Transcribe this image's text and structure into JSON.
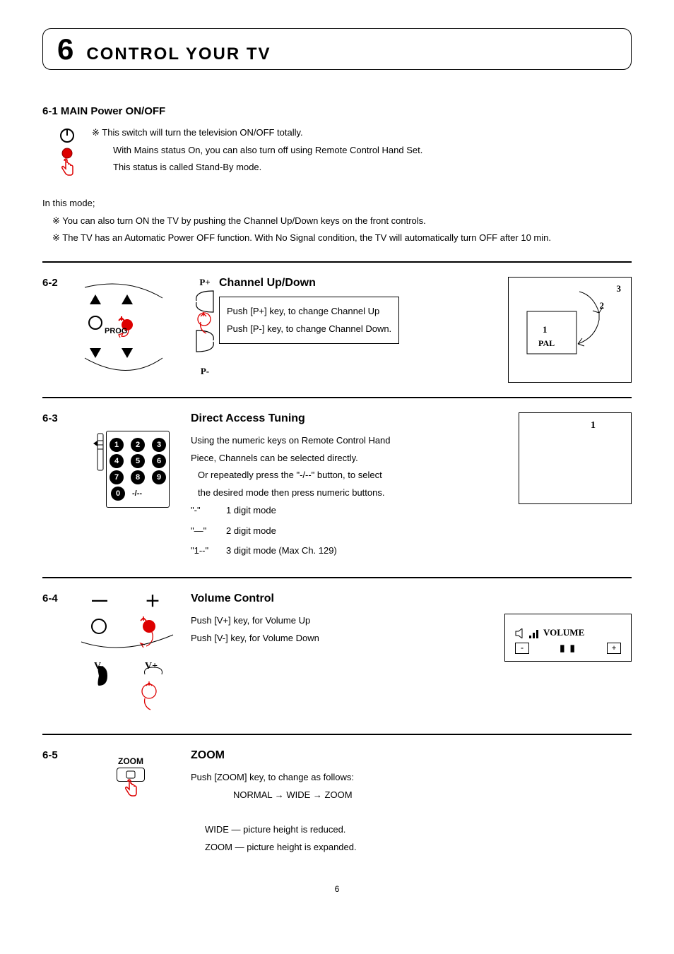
{
  "chapter": {
    "number": "6",
    "title": "CONTROL YOUR TV"
  },
  "s61": {
    "num": "6-1",
    "title": "MAIN Power ON/OFF",
    "line1": "※ This switch will turn the television ON/OFF totally.",
    "line2": "With Mains status On, you can also turn off using Remote Control Hand Set.",
    "line3": "This status is called Stand-By mode.",
    "mode": "In this mode;",
    "note1": "※ You can also turn ON the TV by pushing the Channel Up/Down keys on the front controls.",
    "note2": "※ The TV has an Automatic Power OFF function. With No Signal condition, the TV will automatically turn OFF after 10 min."
  },
  "s62": {
    "num": "6-2",
    "title": "Channel Up/Down",
    "line1": "Push [P+] key, to change Channel Up",
    "line2": "Push [P-] key, to change Channel Down.",
    "diag": {
      "prog": "PROG",
      "pplus": "P+",
      "pminus": "P-",
      "n1": "1",
      "n2": "2",
      "n3": "3",
      "pal": "PAL"
    }
  },
  "s63": {
    "num": "6-3",
    "title": "Direct Access Tuning",
    "line1": "Using the numeric keys on Remote Control Hand",
    "line2": "Piece, Channels can be selected directly.",
    "line3": "Or repeatedly press the \"-/--\" button, to select",
    "line4": "the desired mode then press numeric buttons.",
    "modes": [
      {
        "key": "\"-\"",
        "desc": "1 digit mode"
      },
      {
        "key": "\"—\"",
        "desc": "2 digit mode"
      },
      {
        "key": "\"1--\"",
        "desc": "3 digit mode (Max Ch. 129)"
      }
    ],
    "keypad": {
      "dash": "-/--",
      "keys": [
        "1",
        "2",
        "3",
        "4",
        "5",
        "6",
        "7",
        "8",
        "9",
        "0"
      ]
    },
    "osd_num": "1"
  },
  "s64": {
    "num": "6-4",
    "title": "Volume Control",
    "line1": "Push [V+] key, for Volume Up",
    "line2": "Push [V-] key, for Volume Down",
    "diag": {
      "vminus": "V-",
      "vplus": "V+",
      "minus_sym": "—",
      "plus_sym": "＋"
    },
    "osd": {
      "label": "VOLUME",
      "bar": "▮ ▮",
      "minus": "-",
      "plus": "+"
    }
  },
  "s65": {
    "num": "6-5",
    "title": "ZOOM",
    "btn": "ZOOM",
    "line1": "Push [ZOOM] key, to change as follows:",
    "sequence": "NORMAL → WIDE → ZOOM",
    "wide": "WIDE — picture height is reduced.",
    "zoom": "ZOOM — picture height is expanded."
  },
  "page_number": "6"
}
